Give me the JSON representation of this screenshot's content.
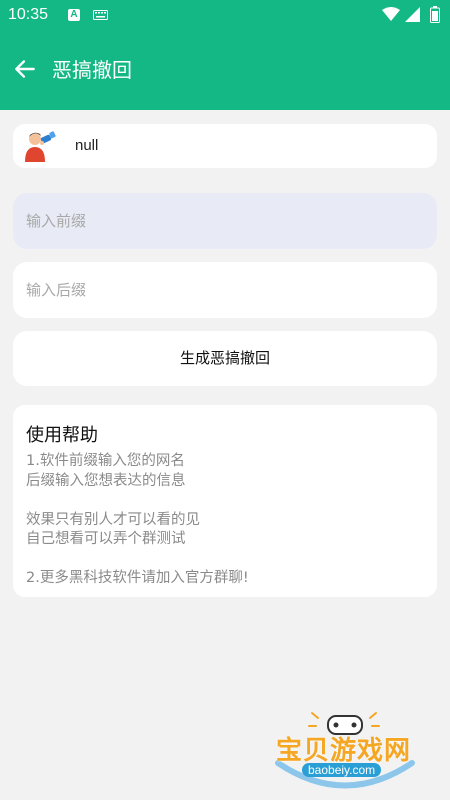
{
  "status_bar": {
    "time": "10:35",
    "notification_icon": "A",
    "icons": [
      "keyboard-icon",
      "wifi-icon",
      "signal-icon",
      "battery-icon"
    ]
  },
  "app_bar": {
    "title": "恶搞撤回",
    "back_icon": "arrow-left-icon",
    "color": "#14b884"
  },
  "user": {
    "name": "null",
    "avatar_icon": "avatar-icon"
  },
  "form": {
    "prefix_placeholder": "输入前缀",
    "prefix_value": "",
    "suffix_placeholder": "输入后缀",
    "suffix_value": "",
    "generate_label": "生成恶搞撤回"
  },
  "help": {
    "title": "使用帮助",
    "lines": [
      "1.软件前缀输入您的网名",
      "后缀输入您想表达的信息",
      "",
      "效果只有别人才可以看的见",
      "自己想看可以弄个群测试",
      "",
      "2.更多黑科技软件请加入官方群聊!"
    ]
  },
  "watermark": {
    "text": "宝贝游戏网",
    "url": "baobeiy.com"
  }
}
